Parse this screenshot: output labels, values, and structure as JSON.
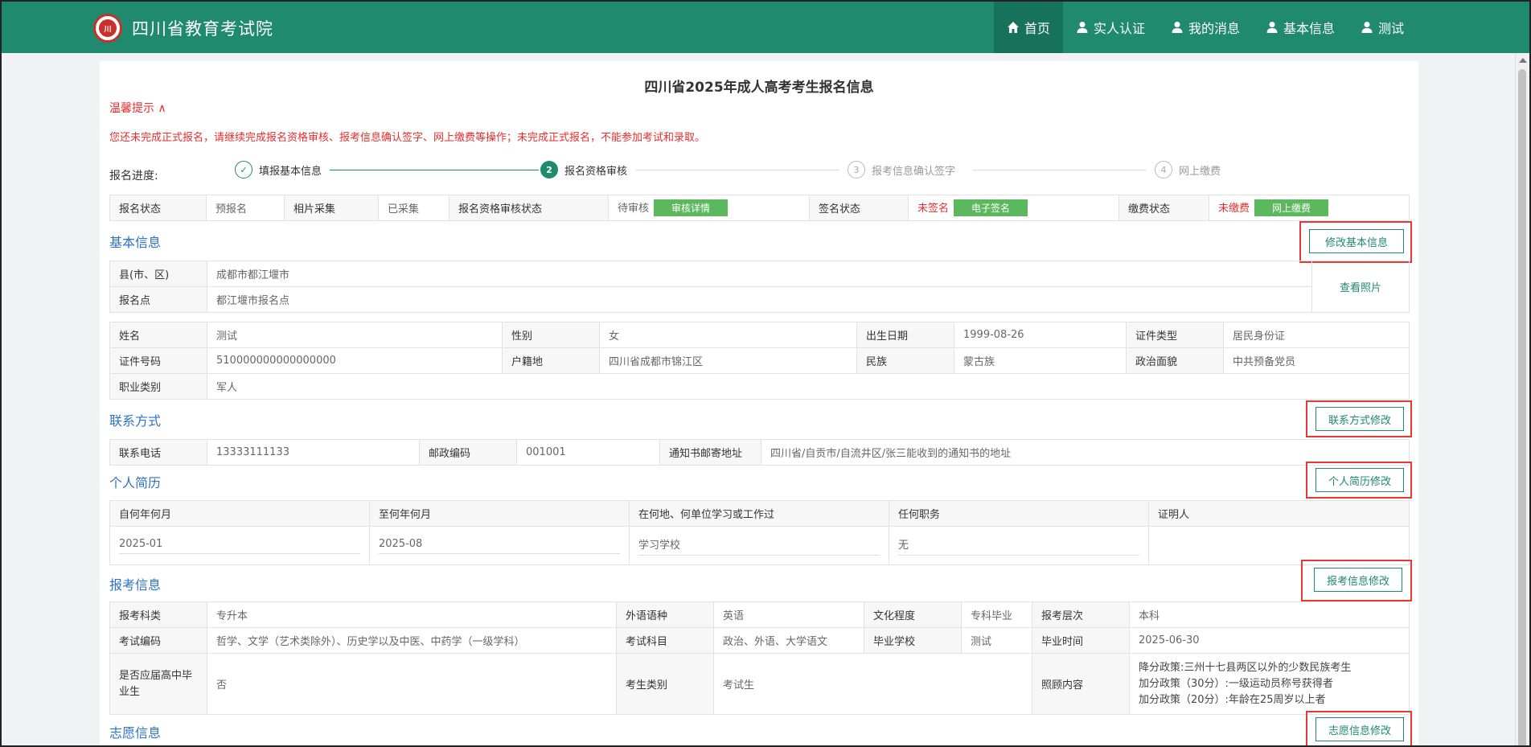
{
  "header": {
    "brand": "四川省教育考试院",
    "nav": [
      "首页",
      "实人认证",
      "我的消息",
      "基本信息",
      "测试"
    ]
  },
  "page": {
    "title": "四川省2025年成人高考考生报名信息",
    "tip_toggle": "温馨提示 ∧",
    "tip_text": "您还未完成正式报名，请继续完成报名资格审核、报考信息确认签字、网上缴费等操作；未完成正式报名，不能参加考试和录取。"
  },
  "progress": {
    "label": "报名进度:",
    "steps": [
      {
        "num": "✓",
        "label": "填报基本信息"
      },
      {
        "num": "2",
        "label": "报名资格审核"
      },
      {
        "num": "3",
        "label": "报考信息确认签字"
      },
      {
        "num": "4",
        "label": "网上缴费"
      }
    ]
  },
  "status": {
    "c1": "报名状态",
    "v1": "预报名",
    "c2": "相片采集",
    "v2": "已采集",
    "c3": "报名资格审核状态",
    "v3": "待审核",
    "b3": "审核详情",
    "c4": "签名状态",
    "v4": "未签名",
    "b4": "电子签名",
    "c5": "缴费状态",
    "v5": "未缴费",
    "b5": "网上缴费"
  },
  "basic": {
    "title": "基本信息",
    "edit": "修改基本信息",
    "county_l": "县(市、区)",
    "county": "成都市都江堰市",
    "site_l": "报名点",
    "site": "都江堰市报名点",
    "photo": "查看照片",
    "name_l": "姓名",
    "name": "测试",
    "sex_l": "性别",
    "sex": "女",
    "birth_l": "出生日期",
    "birth": "1999-08-26",
    "idtype_l": "证件类型",
    "idtype": "居民身份证",
    "id_l": "证件号码",
    "id": "510000000000000000",
    "hukou_l": "户籍地",
    "hukou": "四川省成都市锦江区",
    "nation_l": "民族",
    "nation": "蒙古族",
    "politic_l": "政治面貌",
    "politic": "中共预备党员",
    "job_l": "职业类别",
    "job": "军人"
  },
  "contact": {
    "title": "联系方式",
    "edit": "联系方式修改",
    "phone_l": "联系电话",
    "phone": "13333111133",
    "zip_l": "邮政编码",
    "zip": "001001",
    "addr_l": "通知书邮寄地址",
    "addr": "四川省/自贡市/自流井区/张三能收到的通知书的地址"
  },
  "resume": {
    "title": "个人简历",
    "edit": "个人简历修改",
    "headers": [
      "自何年何月",
      "至何年何月",
      "在何地、何单位学习或工作过",
      "任何职务",
      "证明人"
    ],
    "row": [
      "2025-01",
      "2025-08",
      "学习学校",
      "无",
      ""
    ]
  },
  "exam": {
    "title": "报考信息",
    "edit": "报考信息修改",
    "subj_l": "报考科类",
    "subj": "专升本",
    "lang_l": "外语语种",
    "lang": "英语",
    "edu_l": "文化程度",
    "edu": "专科毕业",
    "level_l": "报考层次",
    "level": "本科",
    "code_l": "考试编码",
    "code": "哲学、文学（艺术类除外）、历史学以及中医、中药学（一级学科）",
    "course_l": "考试科目",
    "course": "政治、外语、大学语文",
    "school_l": "毕业学校",
    "school": "测试",
    "gtime_l": "毕业时间",
    "gtime": "2025-06-30",
    "fresh_l": "是否应届高中毕业生",
    "fresh": "否",
    "type_l": "考生类别",
    "type": "考试生",
    "care_l": "照顾内容",
    "care": [
      "降分政策:三州十七县两区以外的少数民族考生",
      "加分政策（30分）:一级运动员称号获得者",
      "加分政策（20分）:年龄在25周岁以上者"
    ]
  },
  "wish": {
    "title": "志愿信息",
    "edit": "志愿信息修改"
  }
}
